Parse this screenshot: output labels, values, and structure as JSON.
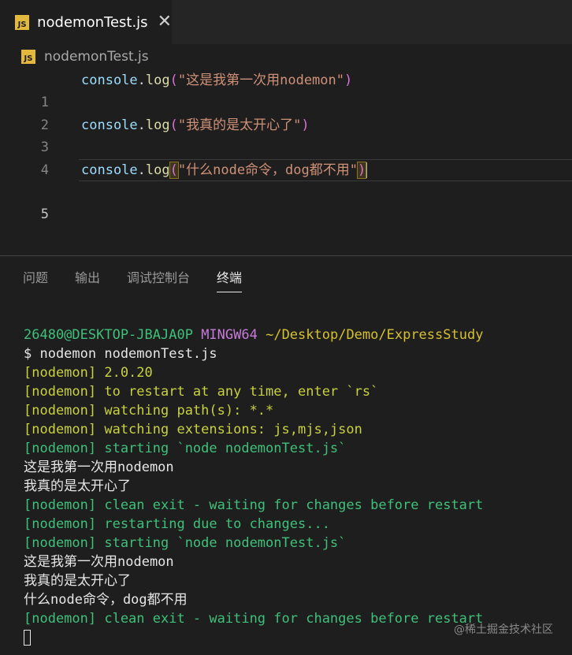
{
  "tab": {
    "badge": "JS",
    "title": "nodemonTest.js",
    "close": "✕"
  },
  "breadcrumb": {
    "badge": "JS",
    "file": "nodemonTest.js"
  },
  "code": [
    {
      "num": "1",
      "obj": "console",
      "dot": ".",
      "fn": "log",
      "open": "(",
      "str": "\"这是我第一次用nodemon\"",
      "close": ")"
    },
    {
      "num": "2"
    },
    {
      "num": "3",
      "obj": "console",
      "dot": ".",
      "fn": "log",
      "open": "(",
      "str": "\"我真的是太开心了\"",
      "close": ")"
    },
    {
      "num": "4"
    },
    {
      "num": "5",
      "obj": "console",
      "dot": ".",
      "fn": "log",
      "open": "(",
      "str": "\"什么node命令，dog都不用\"",
      "close": ")"
    }
  ],
  "panel_tabs": [
    "问题",
    "输出",
    "调试控制台",
    "终端"
  ],
  "terminal": {
    "prompt_user": "26480@DESKTOP-JBAJA0P",
    "prompt_env": "MINGW64",
    "prompt_path": "~/Desktop/Demo/ExpressStudy",
    "command": "$ nodemon nodemonTest.js",
    "lines": [
      {
        "text": "[nodemon] 2.0.20",
        "color": "ygreen"
      },
      {
        "text": "[nodemon] to restart at any time, enter `rs`",
        "color": "ygreen"
      },
      {
        "text": "[nodemon] watching path(s): *.*",
        "color": "ygreen"
      },
      {
        "text": "[nodemon] watching extensions: js,mjs,json",
        "color": "ygreen"
      },
      {
        "text": "[nodemon] starting `node nodemonTest.js`",
        "color": "green"
      },
      {
        "text": "这是我第一次用nodemon",
        "color": "white"
      },
      {
        "text": "我真的是太开心了",
        "color": "white"
      },
      {
        "text": "[nodemon] clean exit - waiting for changes before restart",
        "color": "green"
      },
      {
        "text": "[nodemon] restarting due to changes...",
        "color": "green"
      },
      {
        "text": "[nodemon] starting `node nodemonTest.js`",
        "color": "green"
      },
      {
        "text": "这是我第一次用nodemon",
        "color": "white"
      },
      {
        "text": "我真的是太开心了",
        "color": "white"
      },
      {
        "text": "什么node命令，dog都不用",
        "color": "white"
      },
      {
        "text": "[nodemon] clean exit - waiting for changes before restart",
        "color": "green"
      }
    ]
  },
  "watermark": "@稀土掘金技术社区",
  "colors": {
    "js_badge": "#e2b93d",
    "editor_bg": "#1e1e1e",
    "terminal_green": "#3fc07a"
  }
}
